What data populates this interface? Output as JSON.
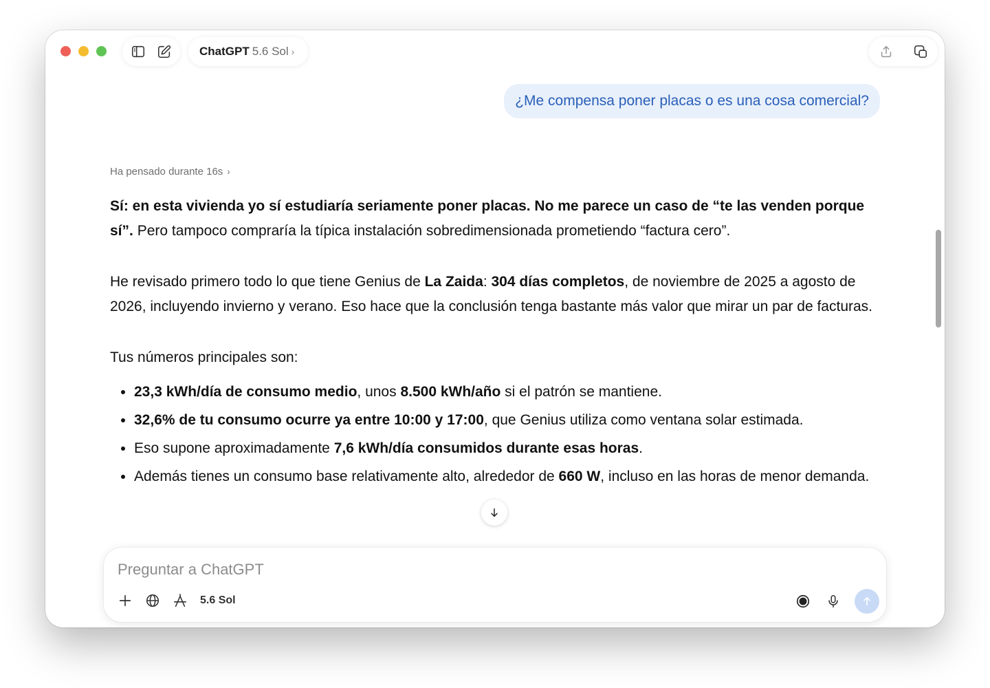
{
  "window": {
    "model_name": "ChatGPT",
    "model_version": "5.6 Sol",
    "chevron": "›"
  },
  "conversation": {
    "user_message": "¿Me compensa poner placas o es una cosa comercial?",
    "thought_label": "Ha pensado durante 16s",
    "thought_chevron": "›",
    "p1": {
      "b1": "Sí: en esta vivienda yo sí estudiaría seriamente poner placas. No me parece un caso de “te las venden porque sí”.",
      "t1": " Pero tampoco compraría la típica instalación sobredimensionada prometiendo “factura cero”."
    },
    "p2": {
      "t1": "He revisado primero todo lo que tiene Genius de ",
      "b1": "La Zaida",
      "t2": ": ",
      "b2": "304 días completos",
      "t3": ", de noviembre de 2025 a agosto de 2026, incluyendo invierno y verano. Eso hace que la conclusión tenga bastante más valor que mirar un par de facturas."
    },
    "p3": "Tus números principales son:",
    "bullets": [
      {
        "b1": "23,3 kWh/día de consumo medio",
        "t1": ", unos ",
        "b2": "8.500 kWh/año",
        "t2": " si el patrón se mantiene."
      },
      {
        "b1": "32,6% de tu consumo ocurre ya entre 10:00 y 17:00",
        "t1": ", que Genius utiliza como ventana solar estimada."
      },
      {
        "t1": "Eso supone aproximadamente ",
        "b1": "7,6 kWh/día consumidos durante esas horas",
        "t2": "."
      },
      {
        "t1": "Además tienes un consumo base relativamente alto, alrededor de ",
        "b1": "660 W",
        "t2": ", incluso en las horas de menor demanda."
      }
    ]
  },
  "composer": {
    "placeholder": "Preguntar a ChatGPT",
    "model_tag": "5.6 Sol"
  },
  "icons": {
    "sidebar_toggle": "sidebar-icon",
    "new_chat": "edit-icon",
    "share": "share-icon",
    "temporary_chat": "copy-chat-icon",
    "attach": "plus-icon",
    "web": "globe-icon",
    "tools": "tools-icon",
    "voice_mode": "voice-mode-icon",
    "mic": "microphone-icon",
    "send": "arrow-up-icon",
    "scroll_down": "arrow-down-icon"
  },
  "colors": {
    "user_bubble_bg": "#e8f0fb",
    "user_bubble_text": "#2a5fb8",
    "send_button": "#c9daf6"
  }
}
